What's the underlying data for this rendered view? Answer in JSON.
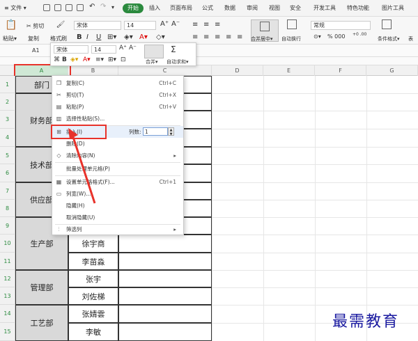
{
  "menubar": {
    "file": "≡ 文件 ▾",
    "tabs": [
      "开始",
      "插入",
      "页面布局",
      "公式",
      "数据",
      "审阅",
      "视图",
      "安全",
      "开发工具",
      "特色功能",
      "图片工具"
    ]
  },
  "ribbon": {
    "paste": "粘贴▾",
    "cut": "✂ 剪切",
    "copy": "复制",
    "format_painter": "格式刷",
    "font_name": "宋体",
    "font_size": "14",
    "merge_center": "合并居中▾",
    "wrap_text": "自动换行",
    "number_format": "常规",
    "percent": "% 000",
    "cond_format": "条件格式▾",
    "table_style": "表"
  },
  "formula_bar": {
    "cell_ref": "A1",
    "fx": "fx"
  },
  "mini_toolbar": {
    "font_name": "宋体",
    "font_size": "14",
    "merge": "合并▾",
    "autosum": "自动求和▾"
  },
  "columns": [
    "A",
    "B",
    "C",
    "D",
    "E",
    "F",
    "G"
  ],
  "rows": [
    "1",
    "2",
    "3",
    "4",
    "5",
    "6",
    "7",
    "8",
    "9",
    "10",
    "11",
    "12",
    "13",
    "14",
    "15"
  ],
  "table": {
    "dept_header": "部门",
    "depts": [
      "财务部",
      "技术部",
      "供应部",
      "生产部",
      "管理部",
      "工艺部"
    ],
    "names": [
      "徐宇商",
      "李苗淼",
      "张宇",
      "刘佐梯",
      "张婧雲",
      "李敏"
    ]
  },
  "context_menu": {
    "items": [
      {
        "label": "复制(C)",
        "shortcut": "Ctrl+C",
        "icon": "copy-icon"
      },
      {
        "label": "剪切(T)",
        "shortcut": "Ctrl+X",
        "icon": "cut-icon"
      },
      {
        "label": "粘贴(P)",
        "shortcut": "Ctrl+V",
        "icon": "paste-icon"
      },
      {
        "label": "选择性粘贴(S)...",
        "shortcut": "",
        "icon": "paste-special-icon"
      },
      {
        "label": "插入(I)",
        "shortcut": "",
        "icon": "insert-icon"
      },
      {
        "label": "删除(D)",
        "shortcut": "",
        "icon": ""
      },
      {
        "label": "清除内容(N)",
        "shortcut": "▸",
        "icon": "clear-icon"
      },
      {
        "label": "批量处理单元格(P)",
        "shortcut": "",
        "icon": ""
      },
      {
        "label": "设置单元格格式(F)...",
        "shortcut": "Ctrl+1",
        "icon": "format-cells-icon"
      },
      {
        "label": "列宽(W)...",
        "shortcut": "",
        "icon": "column-width-icon"
      },
      {
        "label": "隐藏(H)",
        "shortcut": "",
        "icon": ""
      },
      {
        "label": "取消隐藏(U)",
        "shortcut": "",
        "icon": ""
      },
      {
        "label": "筛选列",
        "shortcut": "▸",
        "icon": "filter-icon"
      }
    ],
    "insert_count_label": "列数:",
    "insert_count_value": "1"
  },
  "watermark": "最需教育",
  "colors": {
    "accent_green": "#2b8a3e",
    "highlight_red": "#e8322a",
    "watermark_blue": "#1a1aa0"
  }
}
